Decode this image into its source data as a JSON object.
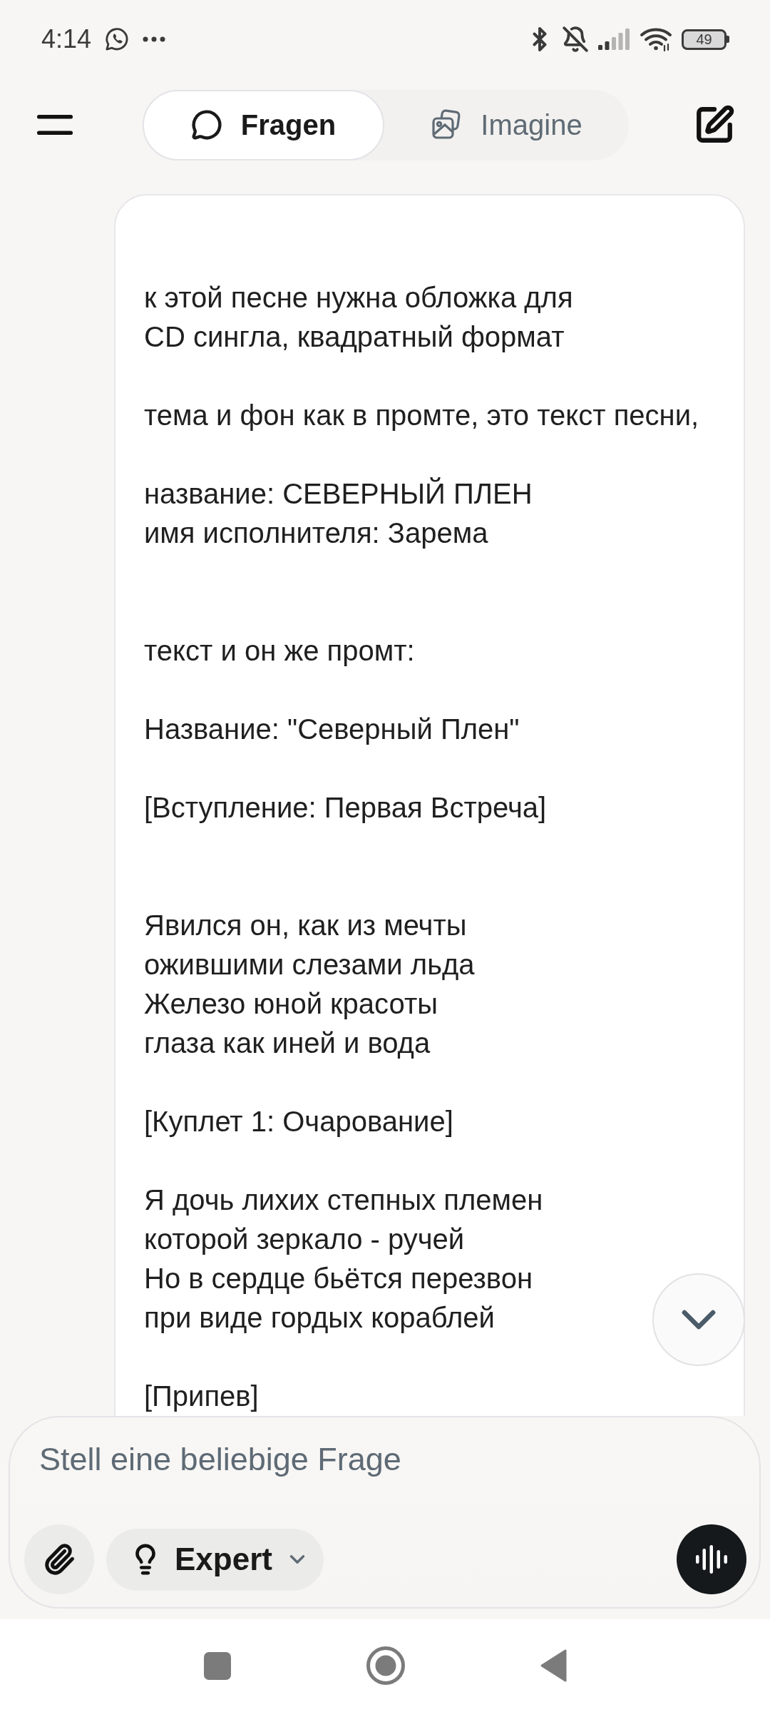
{
  "status_bar": {
    "time": "4:14",
    "battery": "49"
  },
  "header": {
    "tabs": [
      {
        "label": "Fragen",
        "selected": true
      },
      {
        "label": "Imagine",
        "selected": false
      }
    ]
  },
  "message": {
    "text": "к этой песне нужна обложка для\nCD сингла, квадратный формат\n\nтема и фон как в промте, это текст песни,\n\nназвание: СЕВЕРНЫЙ ПЛЕН\nимя исполнителя: Зарема\n\n\nтекст и он же промт:\n\nНазвание: \"Северный Плен\"\n\n[Вступление: Первая Встреча]\n\n\nЯвился он, как из мечты\nожившими слезами льда\nЖелезо юной красоты\nглаза как иней и вода\n\n[Куплет 1: Очарование]\n\nЯ дочь лихих степных племен\nкоторой зеркало - ручей\nНо в сердце бьётся перезвон\nпри виде гордых кораблей\n\n[Припев]"
  },
  "composer": {
    "placeholder": "Stell eine beliebige Frage",
    "mode": "Expert"
  }
}
